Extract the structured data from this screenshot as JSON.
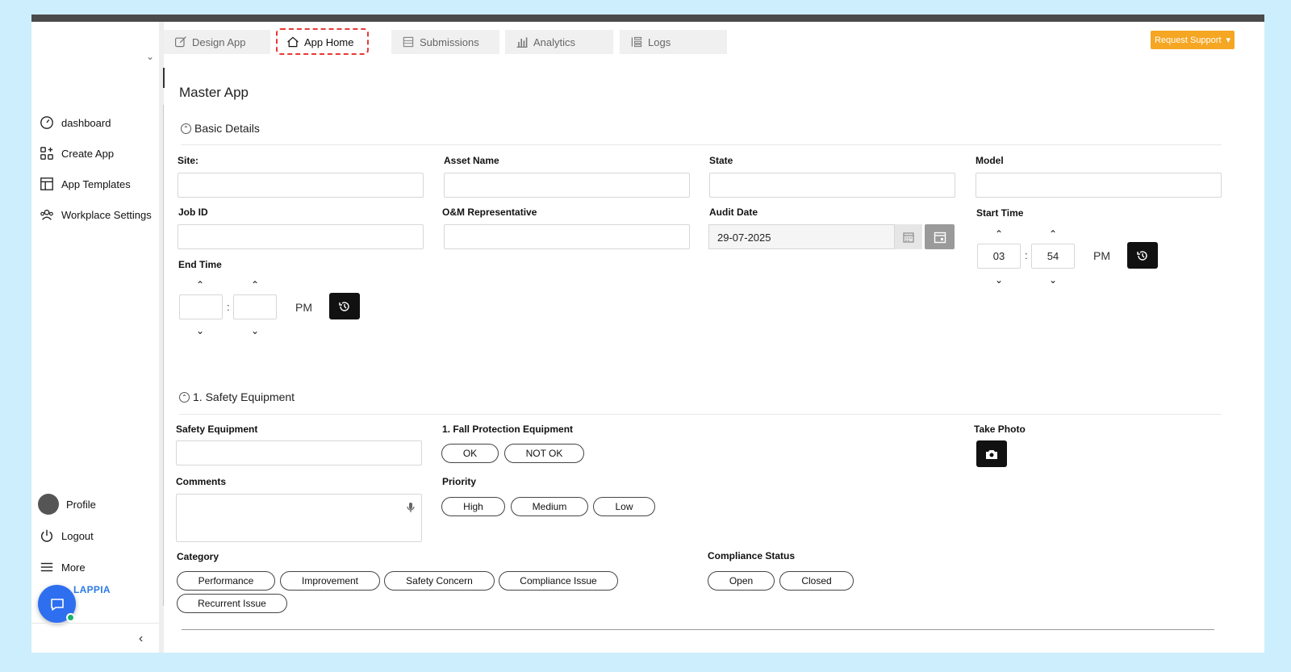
{
  "sidebar": {
    "items": [
      {
        "label": "dashboard",
        "icon": "gauge-icon"
      },
      {
        "label": "Create App",
        "icon": "apps-add-icon"
      },
      {
        "label": "App Templates",
        "icon": "template-icon"
      },
      {
        "label": "Workplace Settings",
        "icon": "team-icon"
      }
    ],
    "profile_label": "Profile",
    "logout_label": "Logout",
    "more_label": "More",
    "brand_partial": "LAPPIA"
  },
  "tabs": [
    {
      "label": "Design App",
      "icon": "edit-icon"
    },
    {
      "label": "App Home",
      "icon": "home-icon"
    },
    {
      "label": "Submissions",
      "icon": "list-icon"
    },
    {
      "label": "Analytics",
      "icon": "bar-chart-icon"
    },
    {
      "label": "Logs",
      "icon": "logs-icon"
    }
  ],
  "request_support": "Request Support",
  "page_title": "Master App",
  "basic_details": {
    "heading": "Basic Details",
    "fields": {
      "site": "Site:",
      "asset_name": "Asset Name",
      "state": "State",
      "model": "Model",
      "job_id": "Job ID",
      "om_rep": "O&M Representative",
      "audit_date": "Audit Date",
      "start_time": "Start Time",
      "end_time": "End Time"
    },
    "audit_date_value": "29-07-2025",
    "start_time": {
      "hour": "03",
      "minute": "54",
      "ampm": "PM"
    },
    "end_time": {
      "hour": "",
      "minute": "",
      "ampm": "PM"
    },
    "colon": ":"
  },
  "safety": {
    "heading": "1. Safety Equipment",
    "safety_equipment_label": "Safety Equipment",
    "fall_protection_label": "1. Fall Protection Equipment",
    "fall_options": [
      "OK",
      "NOT OK"
    ],
    "take_photo_label": "Take Photo",
    "comments_label": "Comments",
    "priority_label": "Priority",
    "priority_options": [
      "High",
      "Medium",
      "Low"
    ],
    "category_label": "Category",
    "category_options": [
      "Performance",
      "Improvement",
      "Safety Concern",
      "Compliance Issue",
      "Recurrent Issue"
    ],
    "compliance_label": "Compliance Status",
    "compliance_options": [
      "Open",
      "Closed"
    ]
  },
  "colors": {
    "accent": "#f5a623",
    "chat": "#2e6ff0",
    "online": "#19b36b",
    "highlight": "#e53935"
  }
}
